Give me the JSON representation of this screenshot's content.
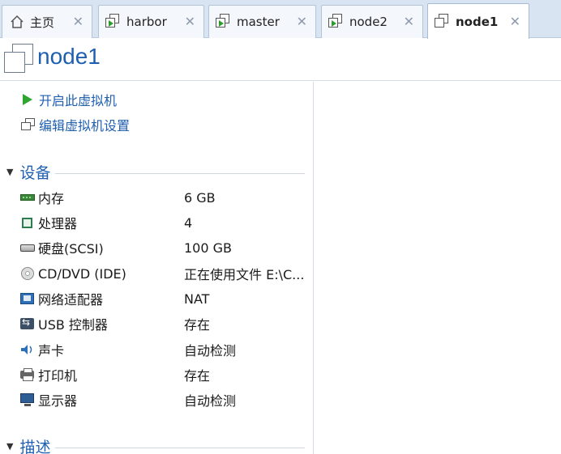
{
  "tabs": [
    {
      "label": "主页",
      "icon": "home-icon",
      "active": false
    },
    {
      "label": "harbor",
      "icon": "vm-running-icon",
      "active": false
    },
    {
      "label": "master",
      "icon": "vm-running-icon",
      "active": false
    },
    {
      "label": "node2",
      "icon": "vm-running-icon",
      "active": false
    },
    {
      "label": "node1",
      "icon": "vm-icon",
      "active": true
    }
  ],
  "tab_close_glyph": "✕",
  "title": {
    "text": "node1",
    "icon": "vm-icon"
  },
  "actions": {
    "power_on": "开启此虚拟机",
    "edit_settings": "编辑虚拟机设置"
  },
  "devices_section": {
    "label": "设备",
    "caret": "▼"
  },
  "devices": [
    {
      "name": "内存",
      "value": "6 GB",
      "icon": "memory-icon"
    },
    {
      "name": "处理器",
      "value": "4",
      "icon": "processor-icon"
    },
    {
      "name": "硬盘(SCSI)",
      "value": "100 GB",
      "icon": "hard-disk-icon"
    },
    {
      "name": "CD/DVD (IDE)",
      "value": "正在使用文件 E:\\C...",
      "icon": "cd-dvd-icon"
    },
    {
      "name": "网络适配器",
      "value": "NAT",
      "icon": "network-adapter-icon"
    },
    {
      "name": "USB 控制器",
      "value": "存在",
      "icon": "usb-controller-icon"
    },
    {
      "name": "声卡",
      "value": "自动检测",
      "icon": "sound-card-icon"
    },
    {
      "name": "打印机",
      "value": "存在",
      "icon": "printer-icon"
    },
    {
      "name": "显示器",
      "value": "自动检测",
      "icon": "display-icon"
    }
  ],
  "description_section": {
    "label": "描述",
    "caret": "▼"
  },
  "colors": {
    "accent": "#1f5fb0",
    "tabbar": "#d9e4f2",
    "play": "#2fa62f"
  }
}
